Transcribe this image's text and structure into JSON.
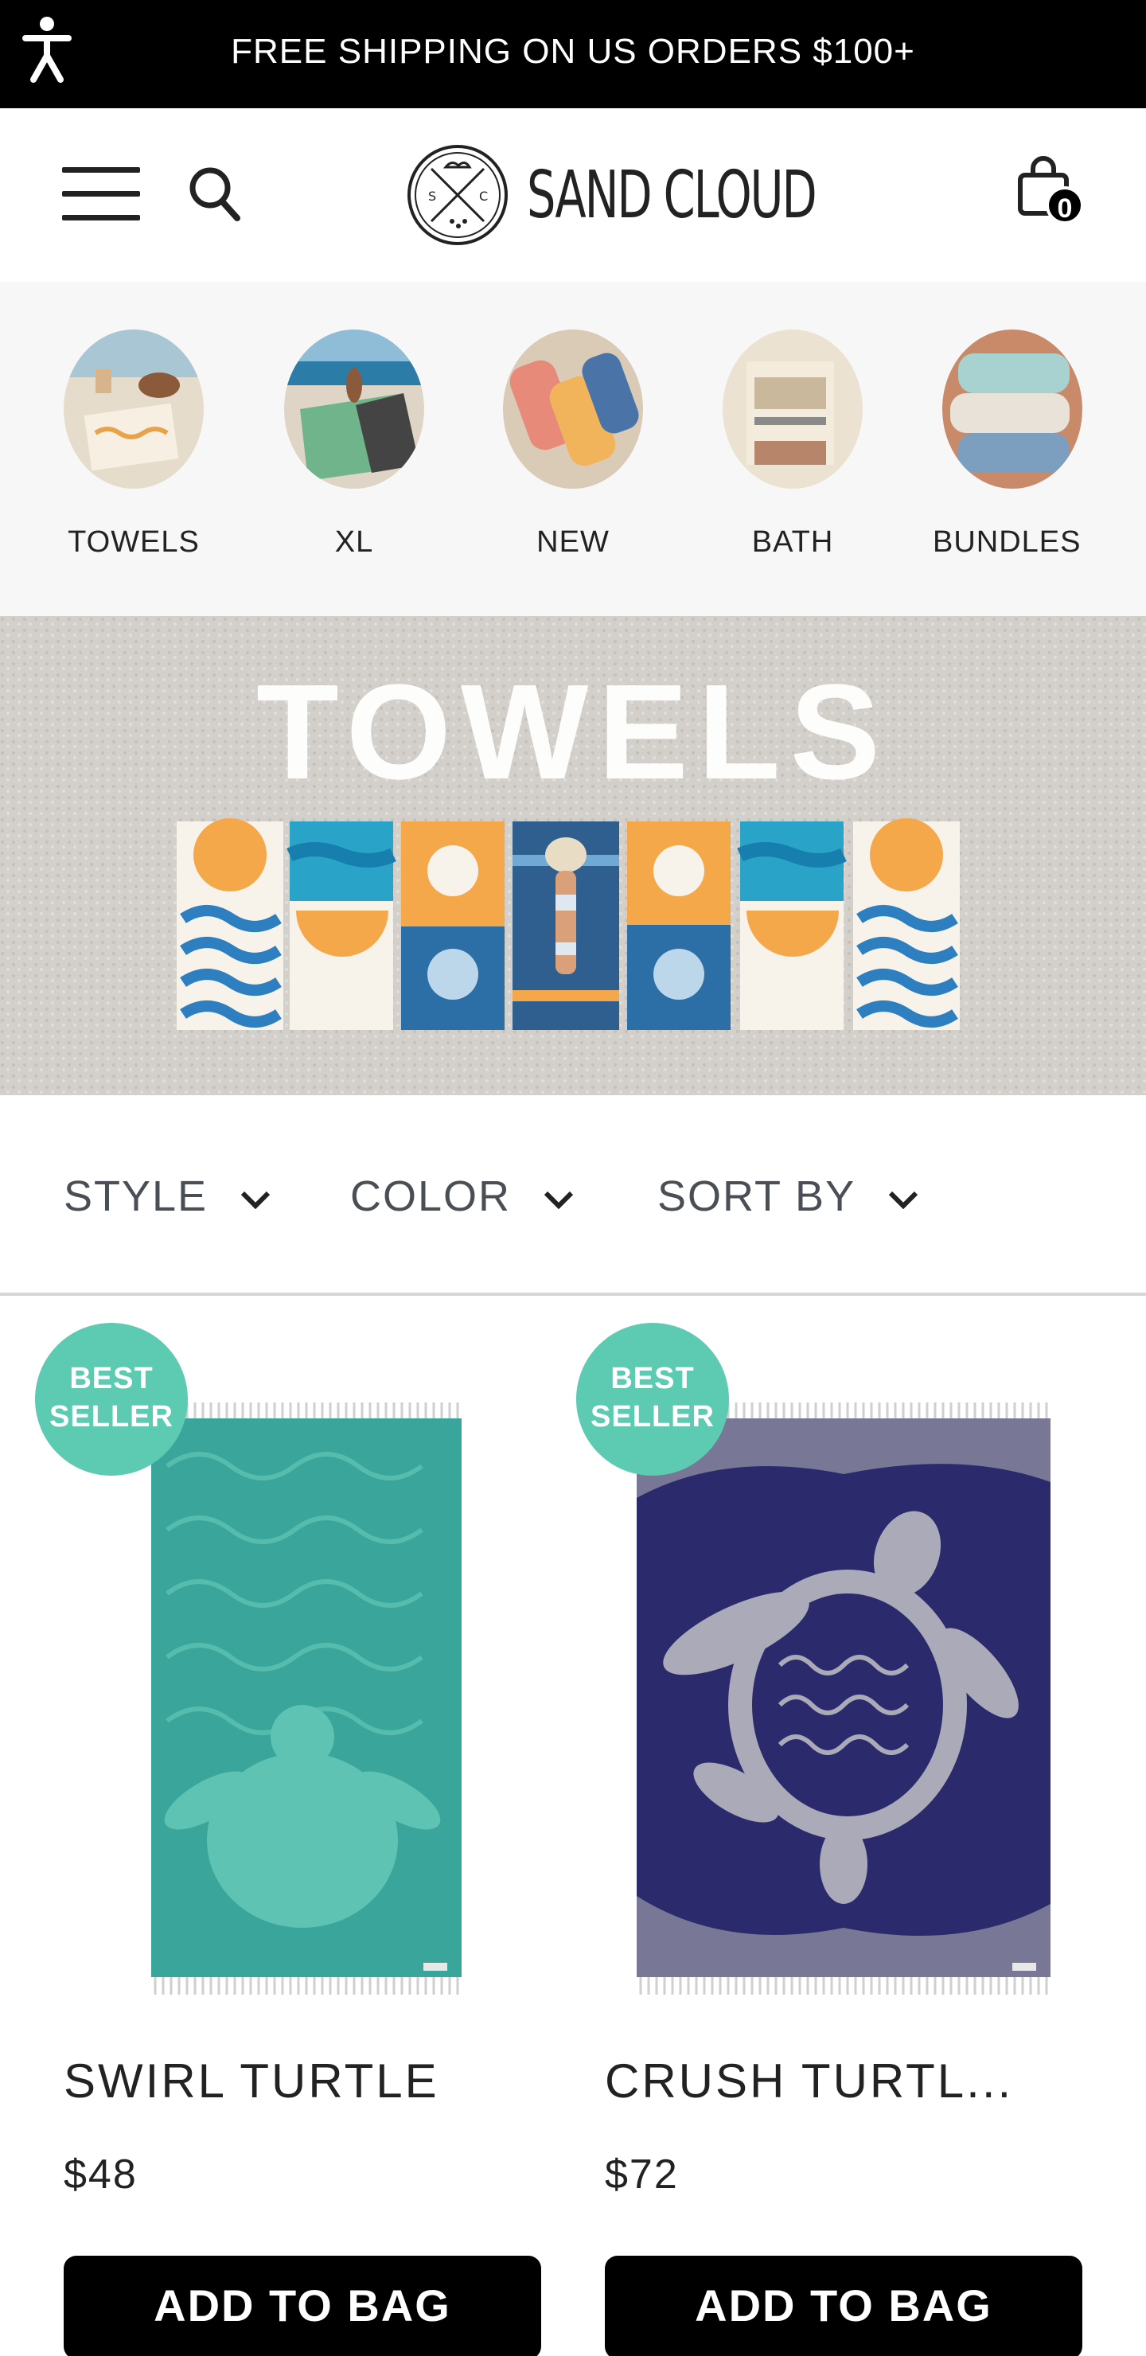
{
  "announcement": {
    "text": "FREE SHIPPING ON US ORDERS $100+"
  },
  "header": {
    "brand": "SAND CLOUD",
    "cart_count": "0"
  },
  "categories": [
    {
      "label": "TOWELS"
    },
    {
      "label": "XL"
    },
    {
      "label": "NEW"
    },
    {
      "label": "BATH"
    },
    {
      "label": "BUNDLES"
    }
  ],
  "hero": {
    "title": "TOWELS"
  },
  "filters": {
    "style": "STYLE",
    "color": "COLOR",
    "sort": "SORT BY"
  },
  "products": [
    {
      "badge_line1": "BEST",
      "badge_line2": "SELLER",
      "name": "SWIRL TURTLE",
      "price": "$48",
      "cta": "ADD TO BAG"
    },
    {
      "badge_line1": "BEST",
      "badge_line2": "SELLER",
      "name": "CRUSH TURTL...",
      "price": "$72",
      "cta": "ADD TO BAG"
    }
  ],
  "colors": {
    "accent_badge": "#5dcbb1",
    "topbar": "#000000",
    "towel_teal": "#3aa59a",
    "towel_navy": "#2b2a6c"
  }
}
